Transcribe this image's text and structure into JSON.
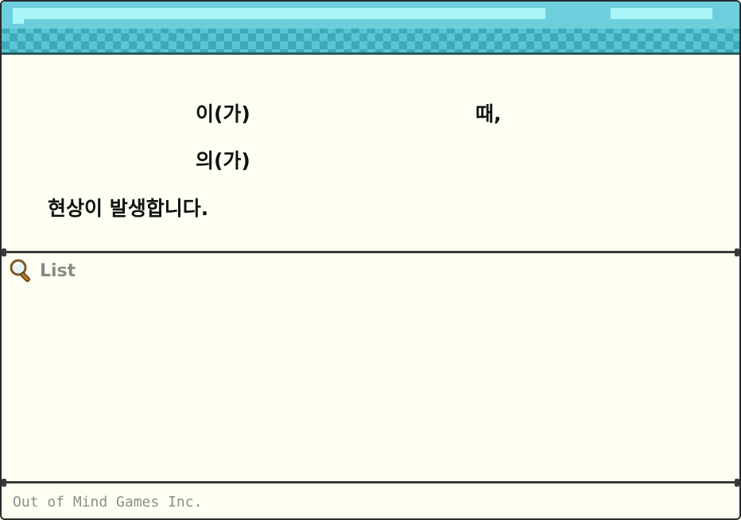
{
  "content": {
    "line1_part1": "이(가)",
    "line1_part2": "때,",
    "line2": "의(가)",
    "line3": "현상이 발생합니다."
  },
  "list": {
    "icon": "magnifier-icon",
    "label": "List"
  },
  "footer": {
    "text": "Out of Mind Games Inc."
  },
  "colors": {
    "titlebar": "#5cc4d2",
    "titlebar_dark": "#3fa9bb",
    "highlight": "#a9f5f7",
    "background": "#fefef2",
    "border": "#2b2b2b"
  }
}
